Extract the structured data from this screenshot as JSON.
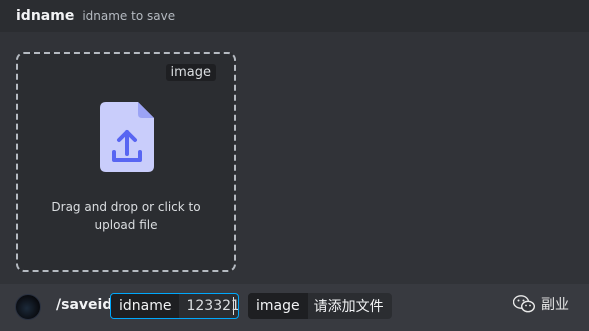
{
  "header": {
    "title": "idname",
    "description": "idname to save"
  },
  "dropzone": {
    "tag": "image",
    "instructions": "Drag and drop or click to upload file",
    "icon": "upload-file-icon"
  },
  "command": {
    "name": "/saveid",
    "options": [
      {
        "label": "idname",
        "value": "123321"
      },
      {
        "label": "image",
        "value": "请添加文件"
      }
    ]
  },
  "watermark": {
    "text": "副业",
    "icon": "wechat-icon"
  },
  "colors": {
    "background": "#313338",
    "header_bg": "#2b2d31",
    "focus_border": "#00a8fc",
    "upload_icon_fill": "#c9cdfb",
    "upload_icon_accent": "#5865f2"
  }
}
